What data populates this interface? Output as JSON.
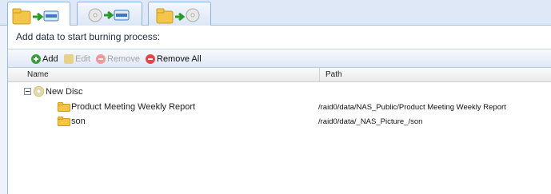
{
  "panel": {
    "title": "Add data to start burning process:"
  },
  "toolbar": {
    "add_label": "Add",
    "edit_label": "Edit",
    "remove_label": "Remove",
    "remove_all_label": "Remove All"
  },
  "grid": {
    "columns": {
      "name": "Name",
      "path": "Path"
    },
    "root": {
      "label": "New Disc"
    },
    "rows": [
      {
        "name": "Product Meeting Weekly Report",
        "path": "/raid0/data/NAS_Public/Product Meeting Weekly Report"
      },
      {
        "name": "son",
        "path": "/raid0/data/_NAS_Picture_/son"
      }
    ]
  },
  "icons": {
    "tab1": "folder-to-disc-image-icon",
    "tab2": "disc-image-to-disc-icon",
    "tab3": "folder-to-disc-icon",
    "add": "add-icon",
    "edit": "edit-icon",
    "remove": "remove-icon",
    "remove_all": "remove-all-icon",
    "root": "disc-icon",
    "row": "folder-icon"
  },
  "colors": {
    "accent": "#99bbe8",
    "add": "#3a9d3a",
    "remove": "#e04848",
    "folder": "#f3c64a"
  }
}
